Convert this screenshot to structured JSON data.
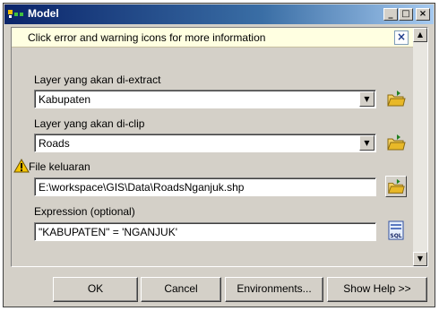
{
  "window": {
    "title": "Model"
  },
  "titlebar_buttons": {
    "minimize": "_",
    "maximize": "□",
    "close": "×"
  },
  "message": {
    "text": "Click error and warning icons for more information",
    "close": "×"
  },
  "scroll": {
    "up": "▲",
    "down": "▼"
  },
  "form": {
    "extract": {
      "label": "Layer yang akan di-extract",
      "value": "Kabupaten",
      "arrow": "▼"
    },
    "clip": {
      "label": "Layer yang akan di-clip",
      "value": "Roads",
      "arrow": "▼"
    },
    "output": {
      "label": "File keluaran",
      "value": "E:\\workspace\\GIS\\Data\\RoadsNganjuk.shp"
    },
    "expression": {
      "label": "Expression (optional)",
      "value": "\"KABUPATEN\" = 'NGANJUK'"
    }
  },
  "buttons": {
    "ok": "OK",
    "cancel": "Cancel",
    "environments": "Environments...",
    "help": "Show Help >>"
  },
  "icons": {
    "folder": "open-folder-icon",
    "sql": "sql-icon",
    "warning": "warning-icon",
    "app": "model-icon"
  },
  "colors": {
    "titlebar": "#0a246a",
    "message_bg": "#ffffe1",
    "warning": "#f5c400",
    "folder": "#e8b828"
  }
}
